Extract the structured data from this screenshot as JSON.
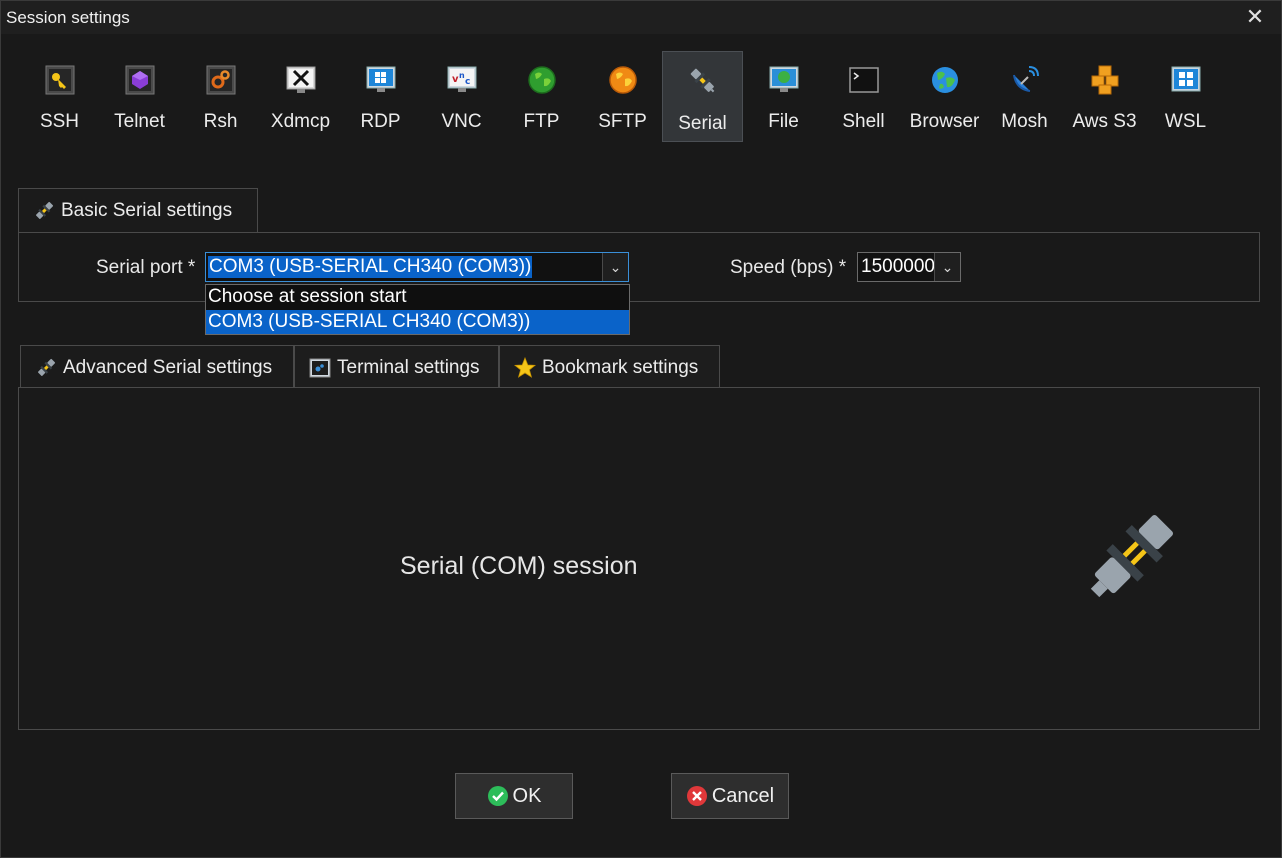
{
  "window": {
    "title": "Session settings",
    "close_glyph": "✕"
  },
  "protocols": [
    {
      "label": "SSH",
      "icon": "key-icon"
    },
    {
      "label": "Telnet",
      "icon": "telnet-gem-icon"
    },
    {
      "label": "Rsh",
      "icon": "gears-icon"
    },
    {
      "label": "Xdmcp",
      "icon": "x-display-icon"
    },
    {
      "label": "RDP",
      "icon": "windows-monitor-icon"
    },
    {
      "label": "VNC",
      "icon": "vnc-icon"
    },
    {
      "label": "FTP",
      "icon": "green-globe-icon"
    },
    {
      "label": "SFTP",
      "icon": "orange-globe-icon"
    },
    {
      "label": "Serial",
      "icon": "plug-icon",
      "active": true
    },
    {
      "label": "File",
      "icon": "monitor-globe-icon"
    },
    {
      "label": "Shell",
      "icon": "terminal-icon"
    },
    {
      "label": "Browser",
      "icon": "earth-icon"
    },
    {
      "label": "Mosh",
      "icon": "satellite-dish-icon"
    },
    {
      "label": "Aws S3",
      "icon": "aws-cubes-icon"
    },
    {
      "label": "WSL",
      "icon": "windows-logo-icon"
    }
  ],
  "basic": {
    "tab_label": "Basic Serial settings",
    "serial_port_label": "Serial port *",
    "serial_port_value": "COM3  (USB-SERIAL CH340 (COM3))",
    "speed_label": "Speed (bps) *",
    "speed_value": "1500000",
    "dropdown_options": [
      {
        "label": "Choose at session start",
        "selected": false
      },
      {
        "label": "COM3  (USB-SERIAL CH340 (COM3))",
        "selected": true
      }
    ]
  },
  "subtabs": [
    {
      "label": "Advanced Serial settings",
      "icon": "plug-icon"
    },
    {
      "label": "Terminal settings",
      "icon": "terminal-settings-icon"
    },
    {
      "label": "Bookmark settings",
      "icon": "star-icon"
    }
  ],
  "description": "Serial (COM) session",
  "buttons": {
    "ok": "OK",
    "cancel": "Cancel"
  },
  "colors": {
    "accent": "#0a63c9",
    "ok_green": "#2dbd5a",
    "cancel_red": "#e0383a"
  }
}
